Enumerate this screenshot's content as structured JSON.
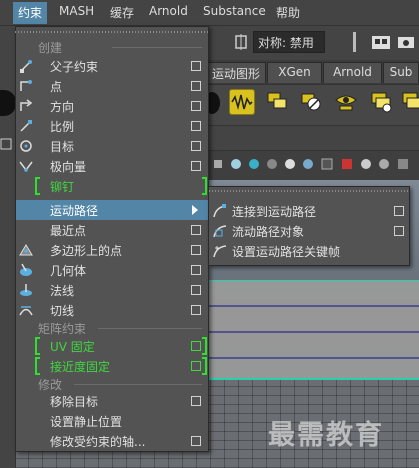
{
  "menubar": {
    "items": [
      "约束",
      "MASH",
      "缓存",
      "Arnold",
      "Substance",
      "帮助"
    ],
    "active_index": 0
  },
  "statusline": {
    "symmetry_text": "对称: 禁用"
  },
  "shelf": {
    "tabs": [
      "运动图形",
      "XGen",
      "Arnold",
      "Sub"
    ]
  },
  "menu": {
    "sections": {
      "create": "创建",
      "matrix": "矩阵约束",
      "modify": "修改"
    },
    "items": [
      {
        "label": "父子约束",
        "icon": "parent-constraint-icon",
        "has_option": true
      },
      {
        "label": "点",
        "icon": "point-constraint-icon",
        "has_option": true
      },
      {
        "label": "方向",
        "icon": "orient-constraint-icon",
        "has_option": true
      },
      {
        "label": "比例",
        "icon": "scale-constraint-icon",
        "has_option": true
      },
      {
        "label": "目标",
        "icon": "aim-constraint-icon",
        "has_option": true
      },
      {
        "label": "极向量",
        "icon": "pole-vector-icon",
        "has_option": true
      },
      {
        "label": "铆钉",
        "icon": "",
        "has_option": false,
        "highlight": "green"
      },
      {
        "label": "运动路径",
        "icon": "",
        "has_option": false,
        "submenu": true
      },
      {
        "label": "最近点",
        "icon": "",
        "has_option": true
      },
      {
        "label": "多边形上的点",
        "icon": "point-on-poly-icon",
        "has_option": true
      },
      {
        "label": "几何体",
        "icon": "geometry-constraint-icon",
        "has_option": true
      },
      {
        "label": "法线",
        "icon": "normal-constraint-icon",
        "has_option": true
      },
      {
        "label": "切线",
        "icon": "tangent-constraint-icon",
        "has_option": true
      },
      {
        "label": "UV 固定",
        "icon": "",
        "has_option": true,
        "highlight": "green"
      },
      {
        "label": "接近度固定",
        "icon": "",
        "has_option": true,
        "highlight": "green"
      },
      {
        "label": "移除目标",
        "icon": "",
        "has_option": true
      },
      {
        "label": "设置静止位置",
        "icon": "",
        "has_option": false
      },
      {
        "label": "修改受约束的轴...",
        "icon": "",
        "has_option": true
      }
    ]
  },
  "submenu": {
    "items": [
      {
        "label": "连接到运动路径",
        "icon": "attach-motion-path-icon",
        "has_option": true
      },
      {
        "label": "流动路径对象",
        "icon": "flow-path-icon",
        "has_option": true
      },
      {
        "label": "设置运动路径关键帧",
        "icon": "set-motion-path-key-icon",
        "has_option": false
      }
    ]
  },
  "watermark": "最需教育",
  "colors": {
    "highlight": "#5285a6",
    "green_marker": "#2fe02f",
    "menu_bg": "#535353",
    "shelf_icon": "#d9c21d"
  }
}
